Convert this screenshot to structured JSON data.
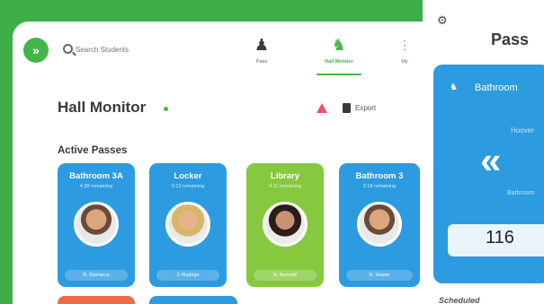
{
  "header": {
    "logo_glyph": "»",
    "search_placeholder": "Search Students",
    "tabs": [
      {
        "label": "Pass",
        "icon": "person-icon"
      },
      {
        "label": "Hall Monitor",
        "icon": "hall-monitor-icon"
      },
      {
        "label": "My",
        "icon": "more-icon"
      }
    ]
  },
  "page": {
    "title": "Hall Monitor",
    "export_label": "Export",
    "section_title": "Active Passes"
  },
  "passes": [
    {
      "destination": "Bathroom 3A",
      "time": "4:38 remaining",
      "student": "R. Demarco",
      "color": "#2d9be0"
    },
    {
      "destination": "Locker",
      "time": "3:12 remaining",
      "student": "J. Rodrigo",
      "color": "#2d9be0"
    },
    {
      "destination": "Library",
      "time": "4:11 remaining",
      "student": "A. Bennett",
      "color": "#86c93e"
    },
    {
      "destination": "Bathroom 3",
      "time": "2:18 remaining",
      "student": "K. Hayes",
      "color": "#2d9be0"
    }
  ],
  "right_panel": {
    "title": "Pass",
    "card_title": "Bathroom",
    "sub1": "Hoover",
    "chevron": "«",
    "sub2": "Bathroom",
    "counter": "116",
    "scheduled_label": "Scheduled"
  },
  "colors": {
    "brand_green": "#43b649",
    "pass_blue": "#2d9be0",
    "alert": "#ef4f6d"
  }
}
